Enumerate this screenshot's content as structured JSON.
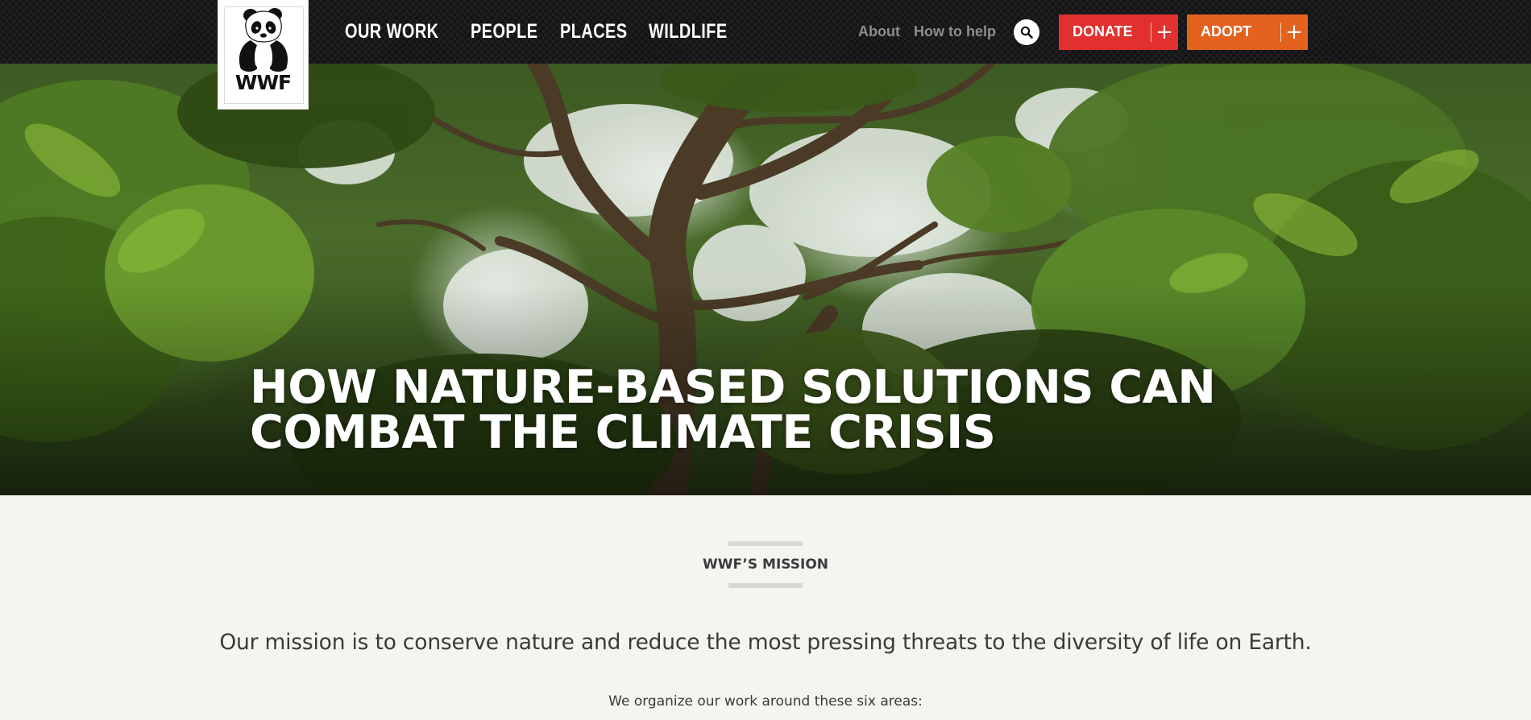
{
  "header": {
    "logo_text": "WWF",
    "main_nav": [
      "OUR WORK",
      "PEOPLE",
      "PLACES",
      "WILDLIFE"
    ],
    "utility_nav": [
      "About",
      "How to help"
    ],
    "search_icon": "search-icon",
    "donate_label": "DONATE",
    "adopt_label": "ADOPT",
    "plus_glyph": "+",
    "colors": {
      "bar": "#141414",
      "donate": "#e1302e",
      "adopt": "#e2621e"
    }
  },
  "hero": {
    "title_line1": "HOW NATURE-BASED SOLUTIONS CAN",
    "title_line2": "COMBAT THE CLIMATE CRISIS"
  },
  "mission": {
    "eyebrow": "WWF’S MISSION",
    "statement": "Our mission is to conserve nature and reduce the most pressing threats to the diversity of life on Earth.",
    "sub": "We organize our work around these six areas:"
  }
}
